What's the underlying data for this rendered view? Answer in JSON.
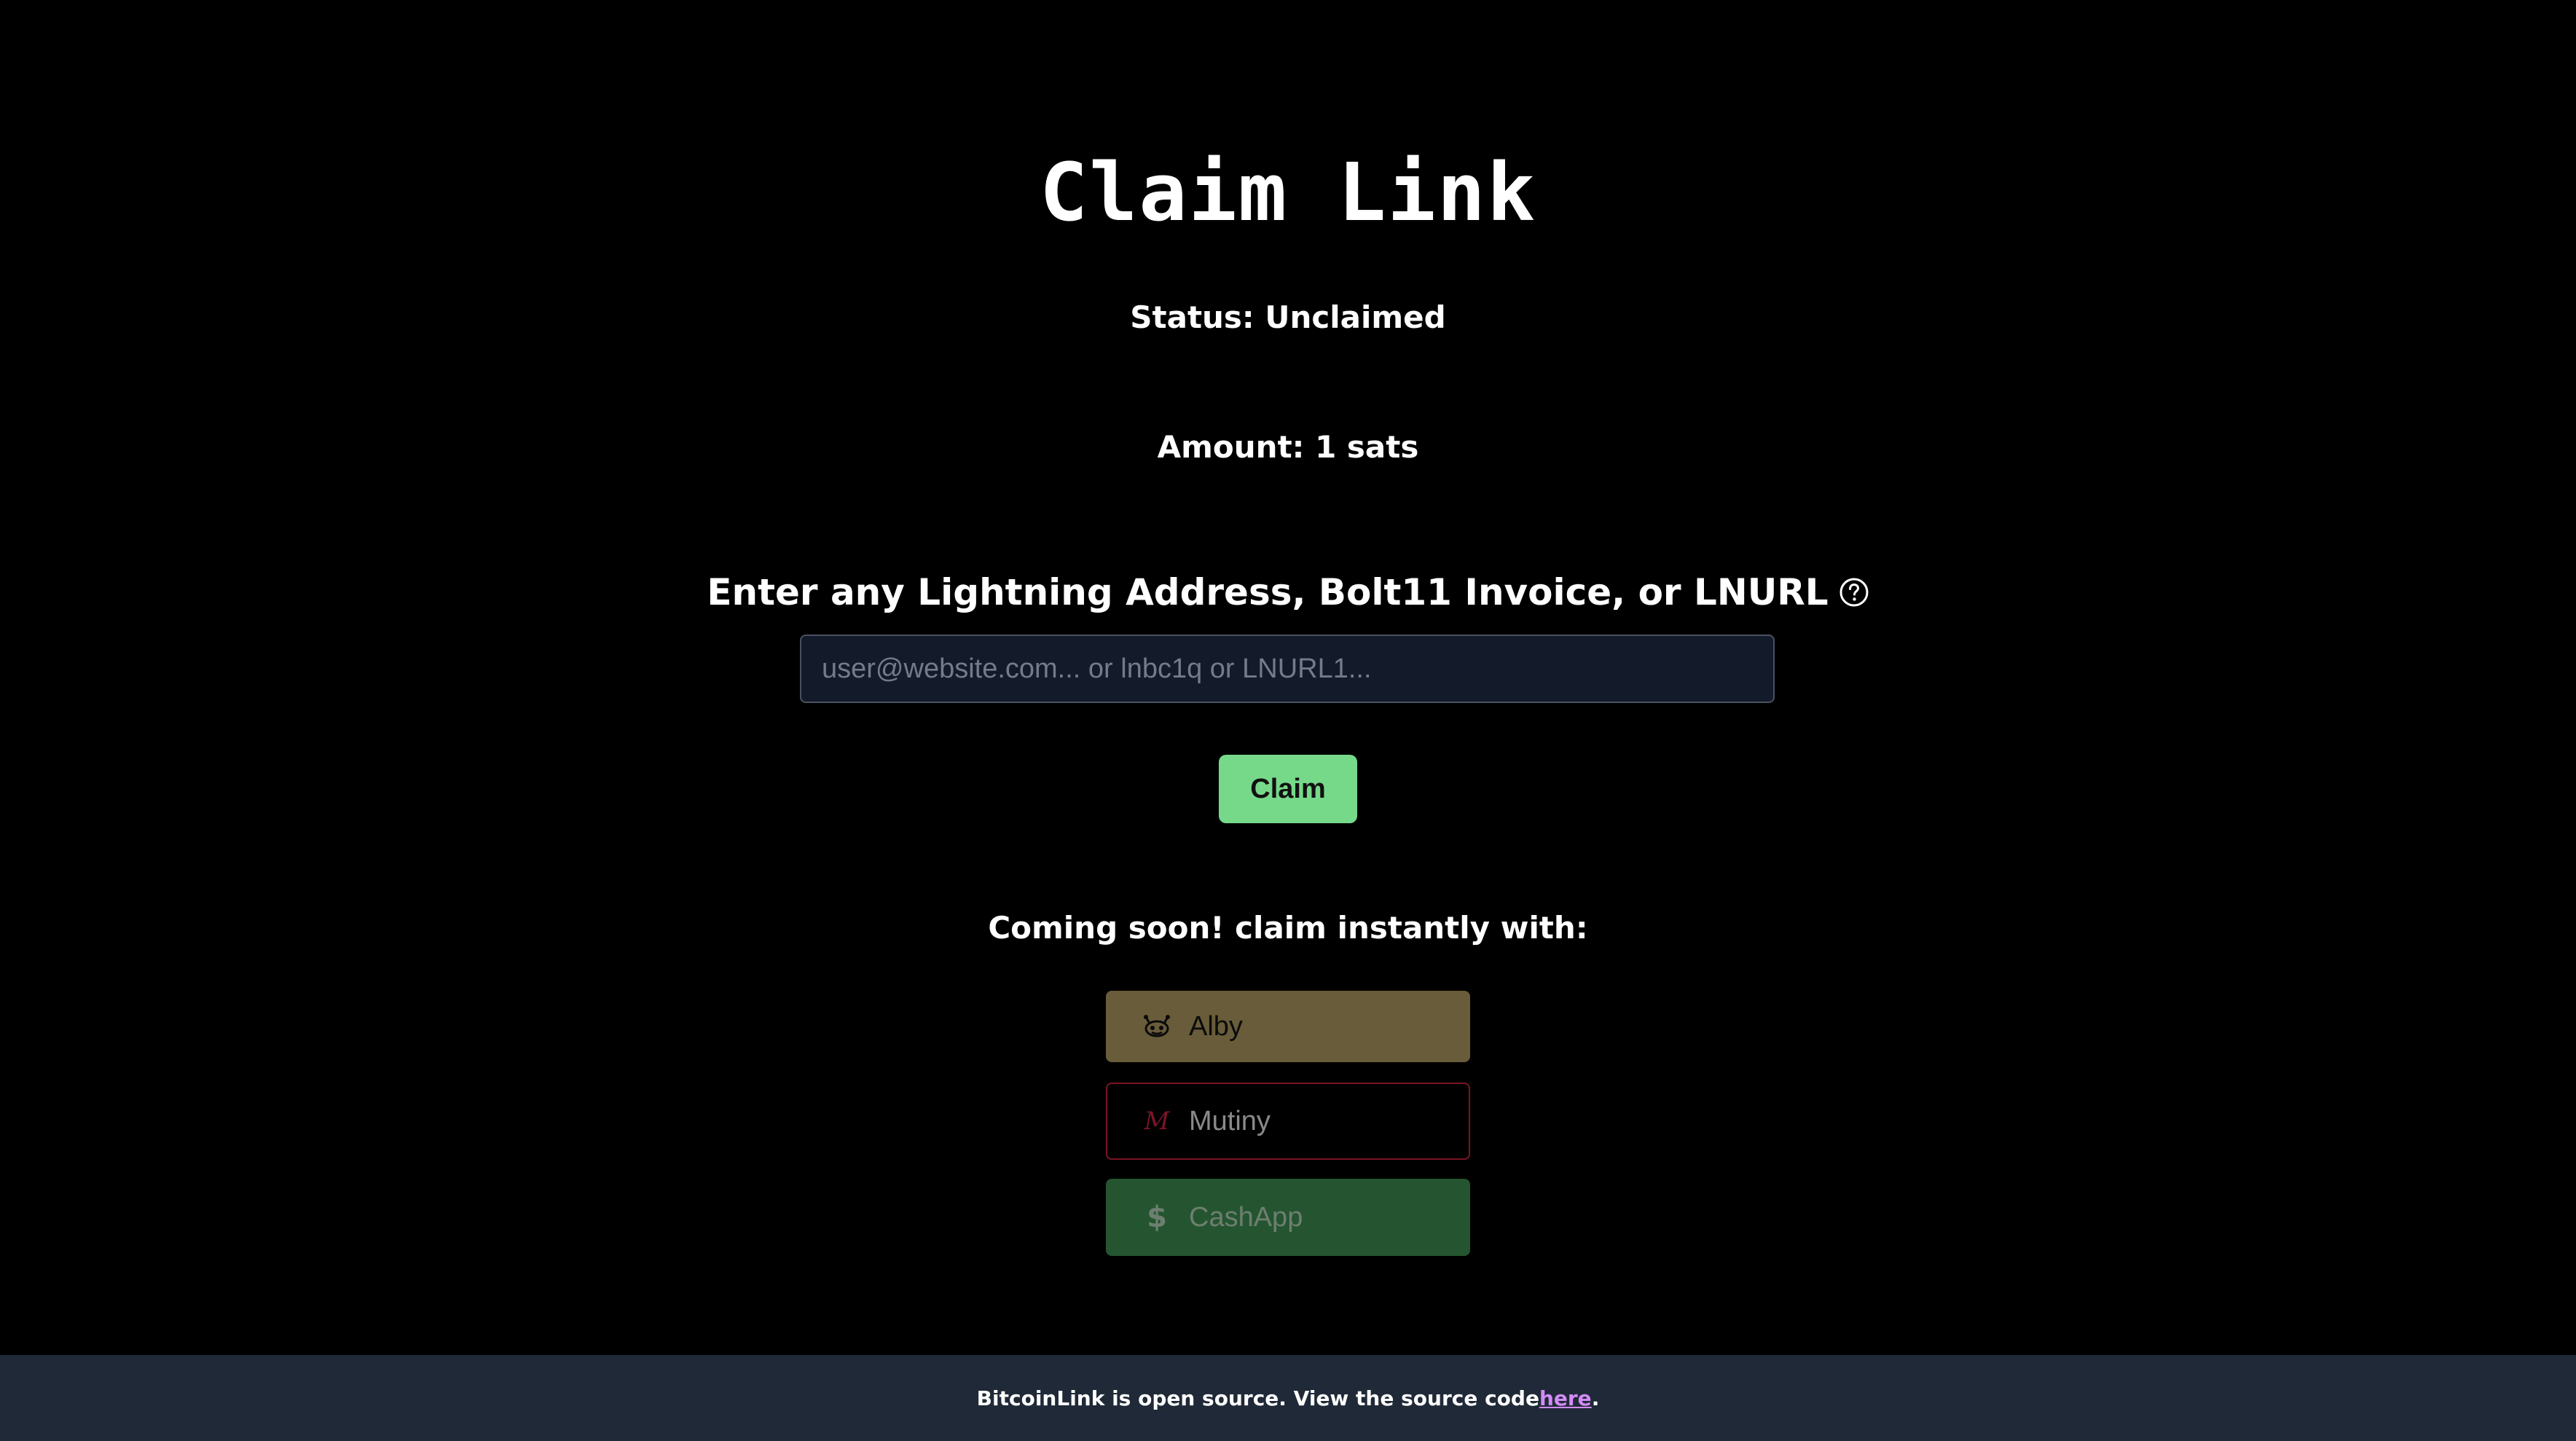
{
  "page": {
    "title": "Claim Link",
    "status_text": "Status: Unclaimed",
    "amount_text": "Amount: 1 sats"
  },
  "claim_form": {
    "label": "Enter any Lightning Address, Bolt11 Invoice, or LNURL",
    "help_icon": "question-circle-icon",
    "input_placeholder": "user@website.com... or lnbc1q or LNURL1...",
    "input_value": "",
    "claim_button_label": "Claim",
    "claim_button_color": "#76d98a"
  },
  "instant_claim": {
    "heading": "Coming soon! claim instantly with:",
    "wallets": [
      {
        "label": "Alby",
        "icon": "alby-bee-icon",
        "color": "#695c3a"
      },
      {
        "label": "Mutiny",
        "icon": "mutiny-m-icon",
        "color": "#7a1426"
      },
      {
        "label": "CashApp",
        "icon": "dollar-icon",
        "color": "#245530"
      }
    ]
  },
  "footer": {
    "text_before": "BitcoinLink is open source. View the source code ",
    "link_text": "here",
    "text_after": ".",
    "background": "#1f2937",
    "link_color": "#d28bf5"
  }
}
